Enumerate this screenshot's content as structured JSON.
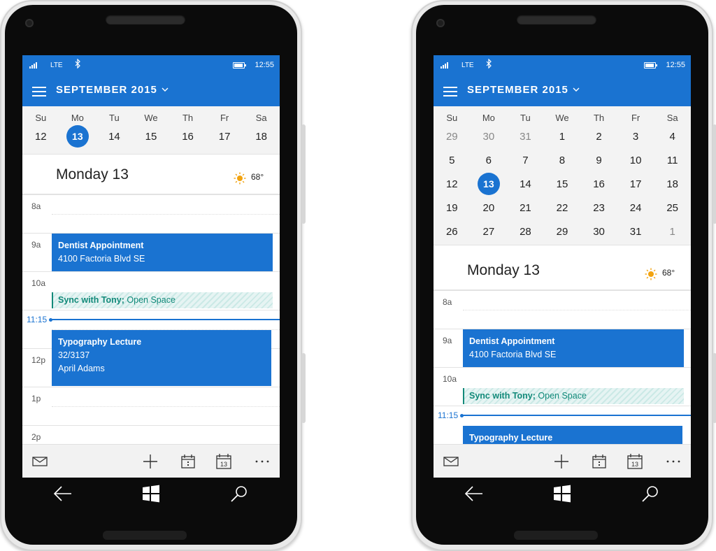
{
  "status_bar": {
    "network": "LTE",
    "time": "12:55"
  },
  "header": {
    "month": "SEPTEMBER 2015"
  },
  "weekdays": [
    "Su",
    "Mo",
    "Tu",
    "We",
    "Th",
    "Fr",
    "Sa"
  ],
  "left_phone": {
    "week": [
      {
        "day": "12",
        "muted": false
      },
      {
        "day": "13",
        "selected": true
      },
      {
        "day": "14"
      },
      {
        "day": "15"
      },
      {
        "day": "16"
      },
      {
        "day": "17"
      },
      {
        "day": "18"
      }
    ],
    "day_title": "Monday 13",
    "temperature": "68°",
    "time_labels": [
      "8a",
      "9a",
      "10a",
      "11:15",
      "12p",
      "1p",
      "2p"
    ],
    "events": {
      "dentist_title": "Dentist Appointment",
      "dentist_location": "4100 Factoria Blvd SE",
      "sync_title": "Sync with Tony;",
      "sync_location": " Open Space",
      "lecture_title": "Typography Lecture",
      "lecture_room": "32/3137",
      "lecture_person": "April Adams"
    }
  },
  "right_phone": {
    "weeks": [
      [
        "29",
        "30",
        "31",
        "1",
        "2",
        "3",
        "4"
      ],
      [
        "5",
        "6",
        "7",
        "8",
        "9",
        "10",
        "11"
      ],
      [
        "12",
        "13",
        "14",
        "15",
        "16",
        "17",
        "18"
      ],
      [
        "19",
        "20",
        "21",
        "22",
        "23",
        "24",
        "25"
      ],
      [
        "26",
        "27",
        "28",
        "29",
        "30",
        "31",
        "1"
      ]
    ],
    "day_title": "Monday 13",
    "temperature": "68°",
    "time_labels": [
      "8a",
      "9a",
      "10a",
      "11:15"
    ],
    "events": {
      "dentist_title": "Dentist Appointment",
      "dentist_location": "4100 Factoria Blvd SE",
      "sync_title": "Sync with Tony;",
      "sync_location": " Open Space",
      "lecture_title": "Typography Lecture"
    }
  },
  "app_bar": {
    "icons": [
      "mail-icon",
      "add-icon",
      "today-icon",
      "month-view-icon",
      "more-icon"
    ],
    "month_icon_day": "13",
    "more_label": "···"
  },
  "colors": {
    "accent": "#1a73d1",
    "event_teal": "#138a7a",
    "sun": "#f2a30f"
  }
}
